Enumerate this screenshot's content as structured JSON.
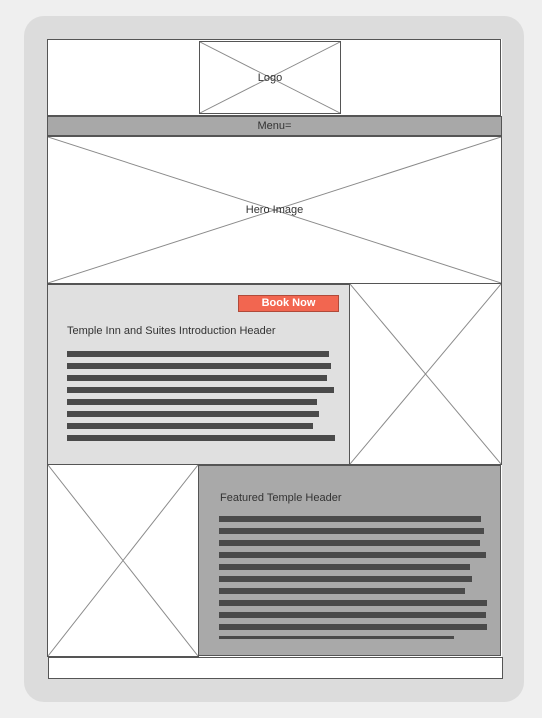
{
  "header": {
    "logo_label": "Logo"
  },
  "nav": {
    "menu_label": "Menu="
  },
  "hero": {
    "label": "Hero Image"
  },
  "intro": {
    "book_button": "Book Now",
    "title": "Temple Inn and Suites Introduction Header"
  },
  "featured": {
    "title": "Featured Temple Header"
  },
  "colors": {
    "page_bg": "#efefef",
    "frame_bg": "#dcdcdc",
    "nav_bg": "#a8a8a8",
    "intro_bg": "#e0e0e0",
    "featured_bg": "#a9a9a9",
    "button_bg": "#f26650",
    "text_line": "#4a4a4a"
  }
}
